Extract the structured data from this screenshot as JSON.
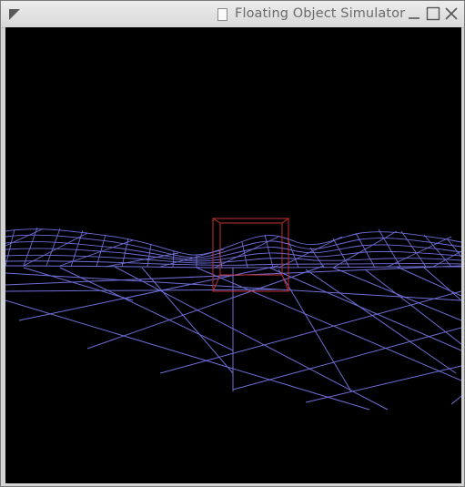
{
  "window": {
    "title": "Floating Object Simulator",
    "window_menu_icon": "window-menu-triangle-icon",
    "title_icon": "document-icon",
    "controls": [
      "minimize-icon",
      "maximize-icon",
      "close-icon"
    ]
  },
  "scene": {
    "background_color": "#000000",
    "water_mesh_color": "#6e6ed8",
    "floating_object_color": "#c03030",
    "floating_object_shape": "wireframe cube"
  }
}
